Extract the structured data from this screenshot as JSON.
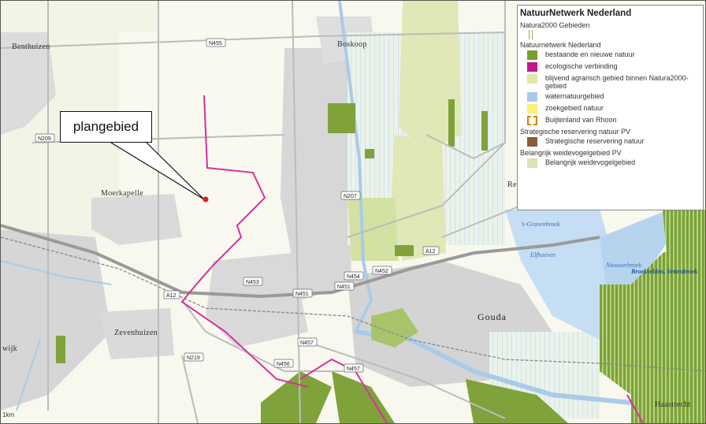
{
  "map": {
    "places": [
      {
        "id": "benthuizen",
        "label": "Benthuizen"
      },
      {
        "id": "boskoop",
        "label": "Boskoop"
      },
      {
        "id": "moerkapelle",
        "label": "Moerkapelle"
      },
      {
        "id": "zevenhuizen",
        "label": "Zevenhuizen"
      },
      {
        "id": "gouda",
        "label": "Gouda"
      },
      {
        "id": "haastrecht",
        "label": "Haastrecht"
      },
      {
        "id": "wijk",
        "label": "wijk"
      },
      {
        "id": "ree",
        "label": "Ree"
      }
    ],
    "water_labels": [
      {
        "id": "s-gravenbroek",
        "label": "'s-Gravenbroek"
      },
      {
        "id": "elfhoeven",
        "label": "Elfhoeven"
      },
      {
        "id": "nieuwerbrug",
        "label": "Nieuwerbroek"
      },
      {
        "id": "broekvelden",
        "label": "Broekvelden, Vettenbroek"
      }
    ],
    "roads": [
      {
        "id": "n455",
        "label": "N455"
      },
      {
        "id": "n209",
        "label": "N209"
      },
      {
        "id": "n207",
        "label": "N207"
      },
      {
        "id": "a12-east",
        "label": "A12"
      },
      {
        "id": "a12-west",
        "label": "A12"
      },
      {
        "id": "n452",
        "label": "N452"
      },
      {
        "id": "n454",
        "label": "N454"
      },
      {
        "id": "n453",
        "label": "N453"
      },
      {
        "id": "n451-a",
        "label": "N451"
      },
      {
        "id": "n451-b",
        "label": "N451"
      },
      {
        "id": "n457-a",
        "label": "N457"
      },
      {
        "id": "n457-b",
        "label": "N457"
      },
      {
        "id": "n456",
        "label": "N456"
      },
      {
        "id": "n219",
        "label": "N219"
      }
    ],
    "scale_label": "1km",
    "colors": {
      "background": "#fbfbf2",
      "nature": "#98b84a",
      "agricultural_natura2000": "#dfe8b6",
      "water": "#c6def3",
      "eco_link": "#d8309b",
      "weidevogel": "#d7e3b0",
      "urban": "#d9d9d9",
      "road": "#bdbdbd",
      "highway": "#9a9a9a"
    }
  },
  "callout": {
    "label": "plangebied"
  },
  "legend": {
    "title": "NatuurNetwerk Nederland",
    "groups": [
      {
        "heading": "Natura2000 Gebieden",
        "items": [
          {
            "icon": "natura2000-hatch-icon",
            "color": "#8fb840",
            "label": ""
          }
        ]
      },
      {
        "heading": "Natuurnetwerk Nederland",
        "items": [
          {
            "icon": "swatch",
            "color": "#7a9e2e",
            "label": "bestaande en nieuwe natuur"
          },
          {
            "icon": "swatch",
            "color": "#c2178a",
            "label": "ecologische verbinding"
          },
          {
            "icon": "swatch",
            "color": "#dfe8a8",
            "label": "blijvend agrarisch gebied binnen Natura2000-gebied"
          },
          {
            "icon": "swatch",
            "color": "#a9cbe8",
            "label": "waternatuurgebied"
          },
          {
            "icon": "swatch",
            "color": "#fbf07a",
            "label": "zoekgebied natuur"
          },
          {
            "icon": "dashed",
            "color": "#c8861c",
            "label": "Buijtenland van Rhoon"
          }
        ]
      },
      {
        "heading": "Strategische reservering natuur PV",
        "items": [
          {
            "icon": "swatch",
            "color": "#8c5a3c",
            "label": "Strategische reservering natuur"
          }
        ]
      },
      {
        "heading": "Belangrijk weidevogelgebied PV",
        "items": [
          {
            "icon": "swatch",
            "color": "#d8e4b4",
            "label": "Belangrijk weidevogelgebied"
          }
        ]
      }
    ]
  }
}
